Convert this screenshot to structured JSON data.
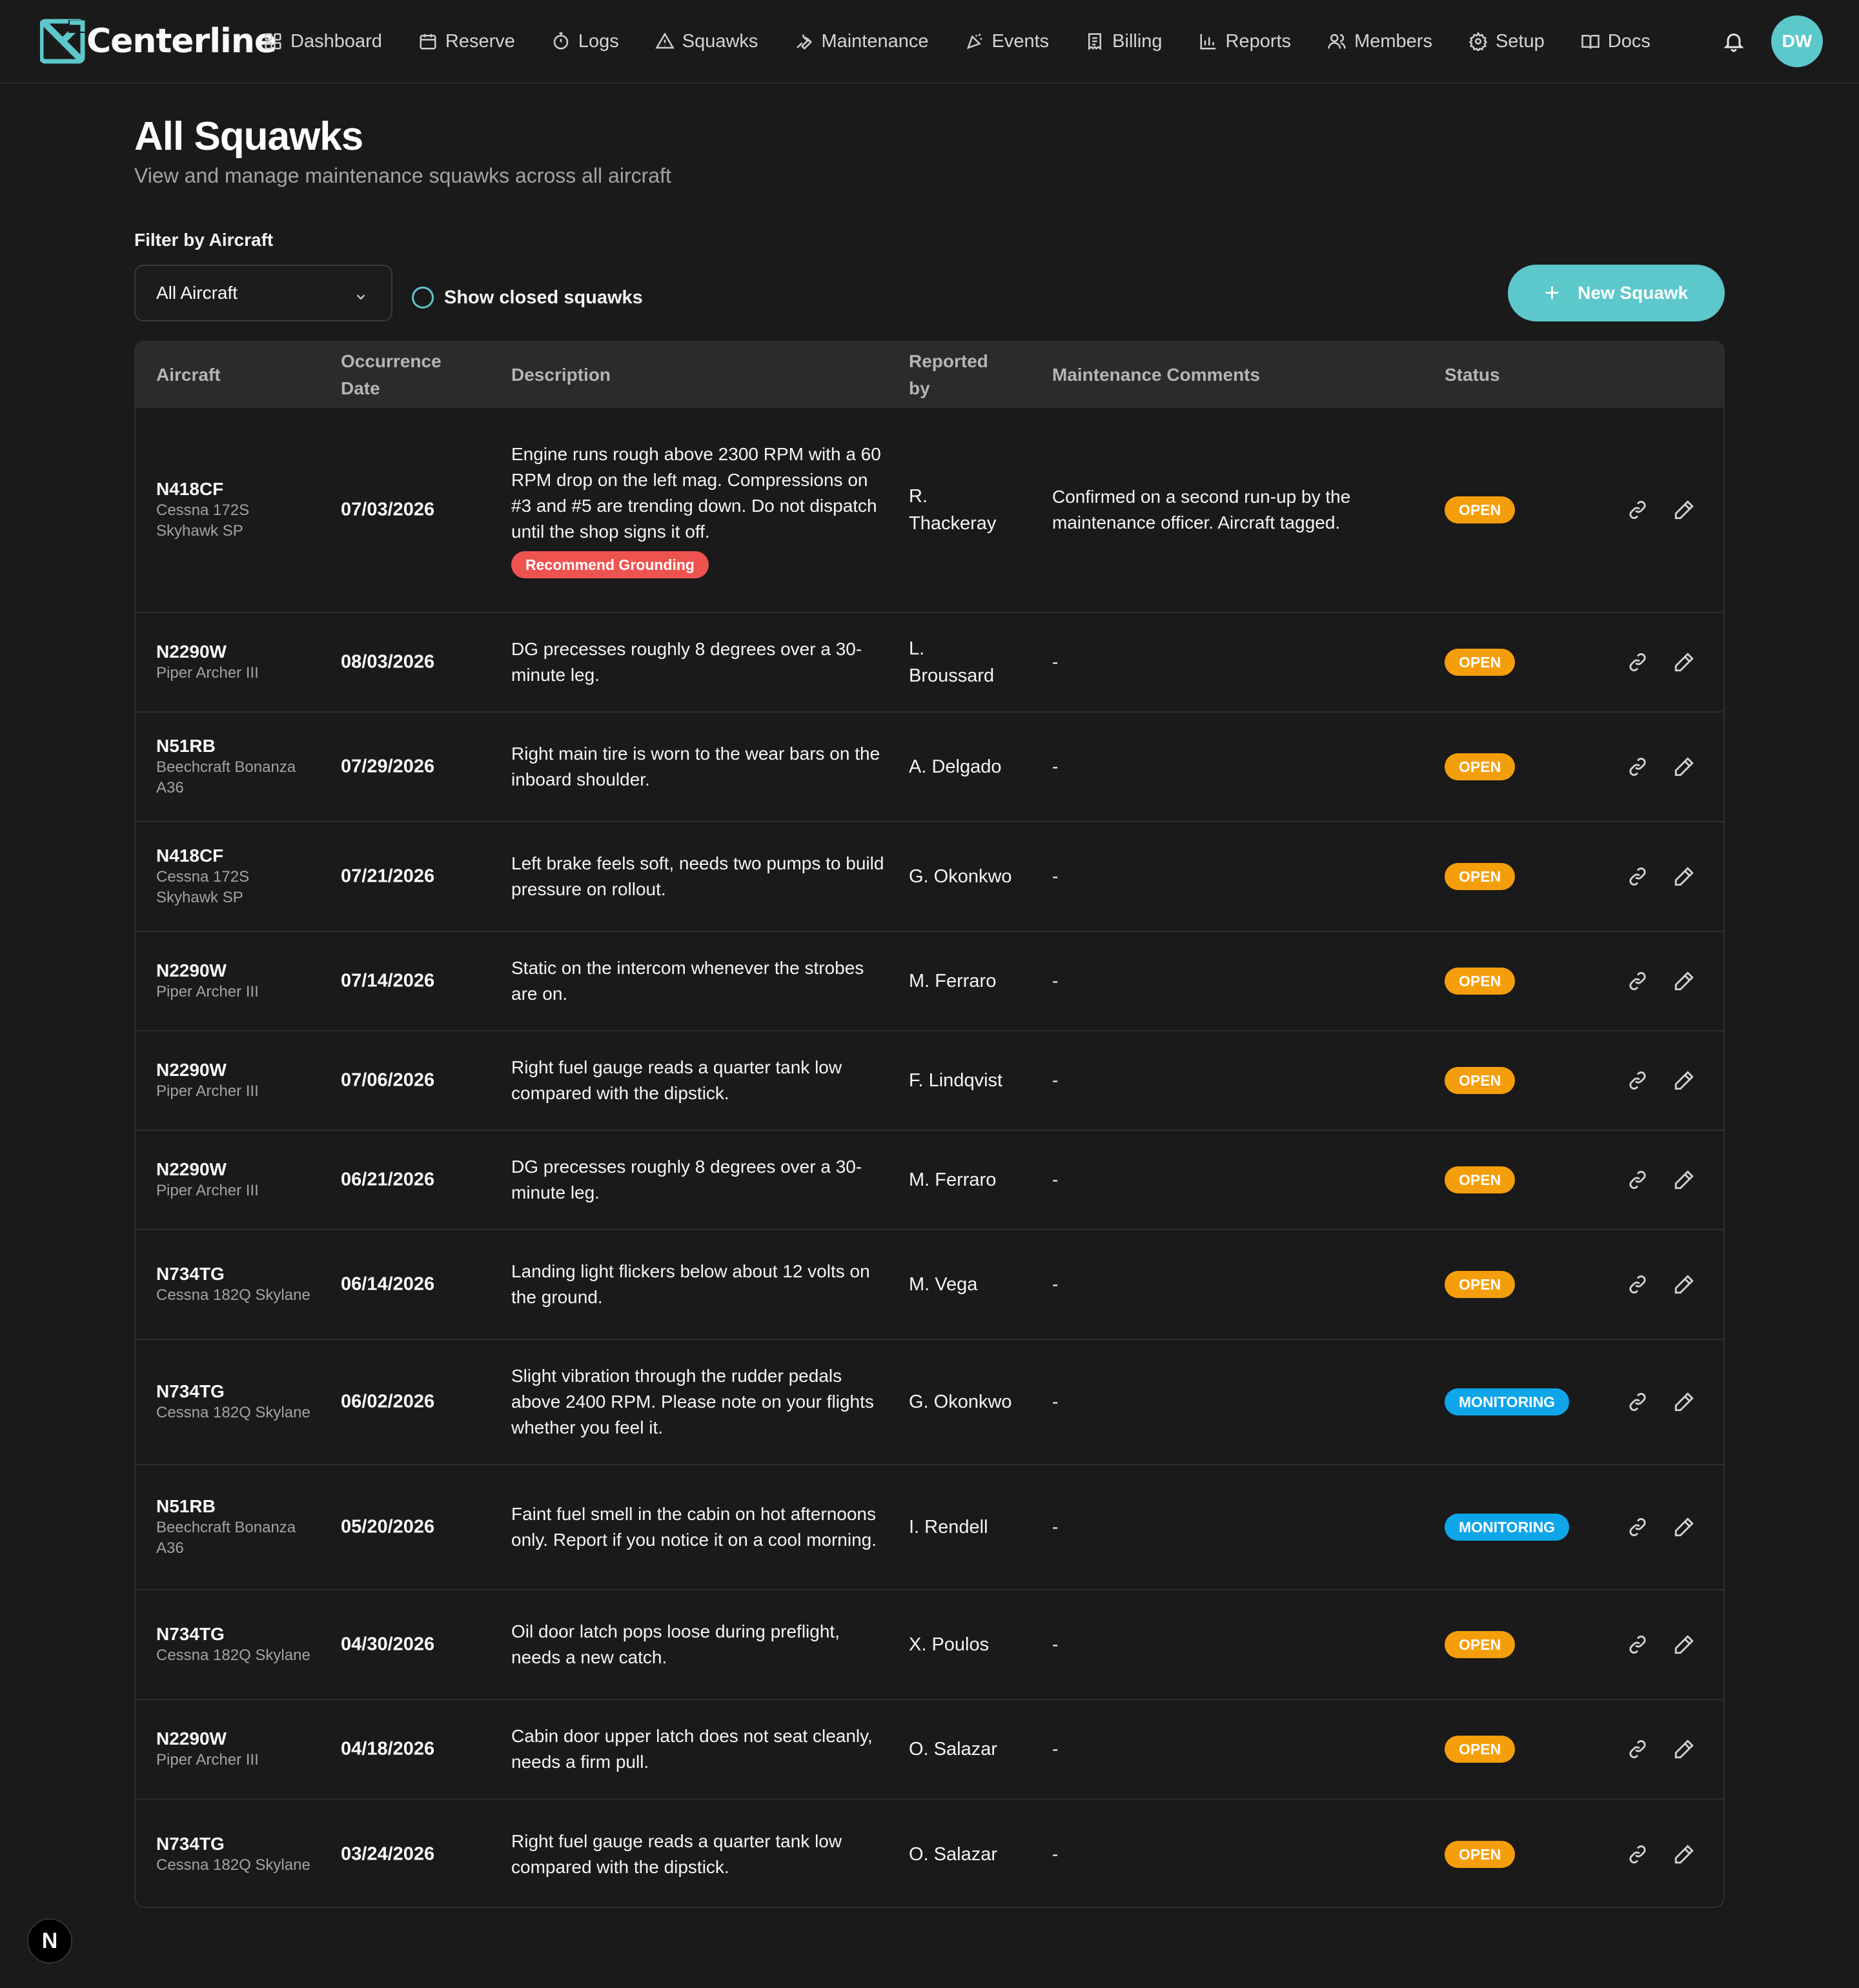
{
  "app": {
    "name": "Centerline",
    "avatar_initials": "DW",
    "accent": "#5cc8cc"
  },
  "nav": [
    {
      "label": "Dashboard",
      "icon": "grid-icon"
    },
    {
      "label": "Reserve",
      "icon": "calendar-icon"
    },
    {
      "label": "Logs",
      "icon": "stopwatch-icon"
    },
    {
      "label": "Squawks",
      "icon": "warning-triangle-icon"
    },
    {
      "label": "Maintenance",
      "icon": "wrench-icon"
    },
    {
      "label": "Events",
      "icon": "party-popper-icon"
    },
    {
      "label": "Billing",
      "icon": "receipt-icon"
    },
    {
      "label": "Reports",
      "icon": "bar-chart-icon"
    },
    {
      "label": "Members",
      "icon": "users-icon"
    },
    {
      "label": "Setup",
      "icon": "gear-icon"
    },
    {
      "label": "Docs",
      "icon": "book-icon"
    }
  ],
  "header": {
    "title": "All Squawks",
    "subtitle": "View and manage maintenance squawks across all aircraft"
  },
  "filters": {
    "label": "Filter by Aircraft",
    "aircraft_selected": "All Aircraft",
    "show_closed_label": "Show closed squawks",
    "show_closed_checked": false
  },
  "new_button_label": "New Squawk",
  "table": {
    "columns": [
      "Aircraft",
      "Occurrence Date",
      "Description",
      "Reported by",
      "Maintenance Comments",
      "Status"
    ],
    "rows": [
      {
        "tail": "N418CF",
        "model": "Cessna 172S Skyhawk SP",
        "date": "07/03/2026",
        "description": "Engine runs rough above 2300 RPM with a 60 RPM drop on the left mag. Compressions on #3 and #5 are trending down. Do not dispatch until the shop signs it off.",
        "flag": "Recommend Grounding",
        "reported_by": "R. Thackeray",
        "comments": "Confirmed on a second run-up by the maintenance officer. Aircraft tagged.",
        "status": "OPEN"
      },
      {
        "tail": "N2290W",
        "model": "Piper Archer III",
        "date": "08/03/2026",
        "description": "DG precesses roughly 8 degrees over a 30-minute leg.",
        "flag": "",
        "reported_by": "L. Broussard",
        "comments": "-",
        "status": "OPEN"
      },
      {
        "tail": "N51RB",
        "model": "Beechcraft Bonanza A36",
        "date": "07/29/2026",
        "description": "Right main tire is worn to the wear bars on the inboard shoulder.",
        "flag": "",
        "reported_by": "A. Delgado",
        "comments": "-",
        "status": "OPEN"
      },
      {
        "tail": "N418CF",
        "model": "Cessna 172S Skyhawk SP",
        "date": "07/21/2026",
        "description": "Left brake feels soft, needs two pumps to build pressure on rollout.",
        "flag": "",
        "reported_by": "G. Okonkwo",
        "comments": "-",
        "status": "OPEN"
      },
      {
        "tail": "N2290W",
        "model": "Piper Archer III",
        "date": "07/14/2026",
        "description": "Static on the intercom whenever the strobes are on.",
        "flag": "",
        "reported_by": "M. Ferraro",
        "comments": "-",
        "status": "OPEN"
      },
      {
        "tail": "N2290W",
        "model": "Piper Archer III",
        "date": "07/06/2026",
        "description": "Right fuel gauge reads a quarter tank low compared with the dipstick.",
        "flag": "",
        "reported_by": "F. Lindqvist",
        "comments": "-",
        "status": "OPEN"
      },
      {
        "tail": "N2290W",
        "model": "Piper Archer III",
        "date": "06/21/2026",
        "description": "DG precesses roughly 8 degrees over a 30-minute leg.",
        "flag": "",
        "reported_by": "M. Ferraro",
        "comments": "-",
        "status": "OPEN"
      },
      {
        "tail": "N734TG",
        "model": "Cessna 182Q Skylane",
        "date": "06/14/2026",
        "description": "Landing light flickers below about 12 volts on the ground.",
        "flag": "",
        "reported_by": "M. Vega",
        "comments": "-",
        "status": "OPEN"
      },
      {
        "tail": "N734TG",
        "model": "Cessna 182Q Skylane",
        "date": "06/02/2026",
        "description": "Slight vibration through the rudder pedals above 2400 RPM. Please note on your flights whether you feel it.",
        "flag": "",
        "reported_by": "G. Okonkwo",
        "comments": "-",
        "status": "MONITORING"
      },
      {
        "tail": "N51RB",
        "model": "Beechcraft Bonanza A36",
        "date": "05/20/2026",
        "description": "Faint fuel smell in the cabin on hot afternoons only. Report if you notice it on a cool morning.",
        "flag": "",
        "reported_by": "I. Rendell",
        "comments": "-",
        "status": "MONITORING"
      },
      {
        "tail": "N734TG",
        "model": "Cessna 182Q Skylane",
        "date": "04/30/2026",
        "description": "Oil door latch pops loose during preflight, needs a new catch.",
        "flag": "",
        "reported_by": "X. Poulos",
        "comments": "-",
        "status": "OPEN"
      },
      {
        "tail": "N2290W",
        "model": "Piper Archer III",
        "date": "04/18/2026",
        "description": "Cabin door upper latch does not seat cleanly, needs a firm pull.",
        "flag": "",
        "reported_by": "O. Salazar",
        "comments": "-",
        "status": "OPEN"
      },
      {
        "tail": "N734TG",
        "model": "Cessna 182Q Skylane",
        "date": "03/24/2026",
        "description": "Right fuel gauge reads a quarter tank low compared with the dipstick.",
        "flag": "",
        "reported_by": "O. Salazar",
        "comments": "-",
        "status": "OPEN"
      }
    ]
  },
  "status_colors": {
    "OPEN": "#f59e0b",
    "MONITORING": "#0ea5e9",
    "grounding": "#ef5350"
  },
  "dev_badge": "N"
}
